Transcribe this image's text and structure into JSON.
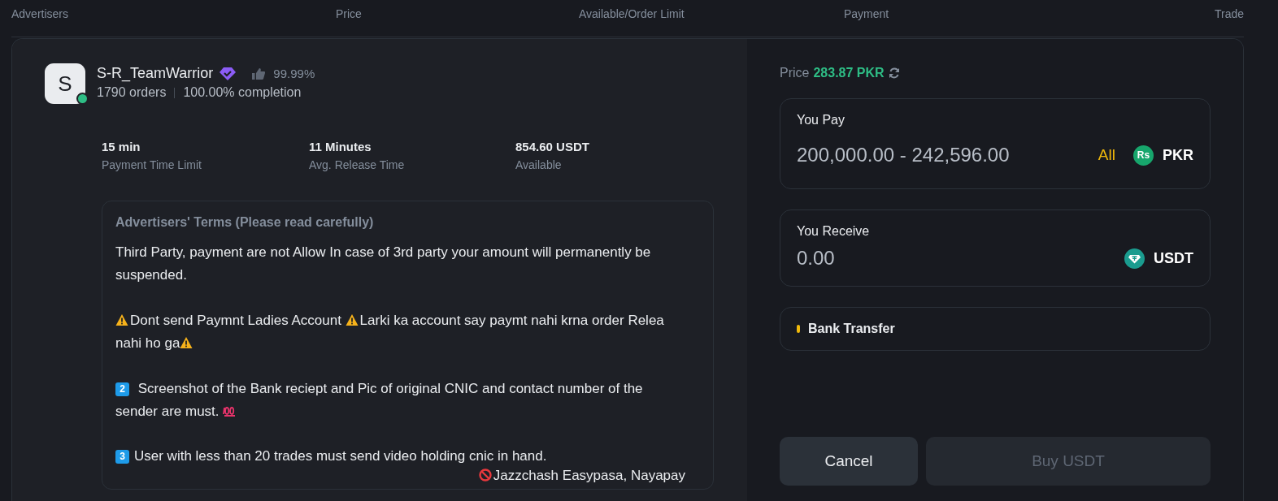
{
  "table": {
    "columns": [
      "Advertisers",
      "Price",
      "Available/Order Limit",
      "Payment",
      "Trade"
    ]
  },
  "advertiser": {
    "avatar_letter": "S",
    "online": true,
    "name": "S-R_TeamWarrior",
    "verified": true,
    "rating": "99.99%",
    "orders": "1790 orders",
    "completion": "100.00% completion",
    "stats": [
      {
        "value": "15 min",
        "label": "Payment Time Limit"
      },
      {
        "value": "11 Minutes",
        "label": "Avg. Release Time"
      },
      {
        "value": "854.60 USDT",
        "label": "Available"
      }
    ]
  },
  "terms": {
    "title": "Advertisers' Terms (Please read carefully)",
    "paragraphs": [
      {
        "lines": [
          [
            {
              "kind": "text",
              "text": "Third Party, payment are  not Allow In case of 3rd party your amount will permanently be"
            }
          ],
          [
            {
              "kind": "text",
              "text": "suspended."
            }
          ]
        ]
      },
      {
        "lines": [
          [
            {
              "kind": "warning"
            },
            {
              "kind": "text",
              "text": "Dont send Paymnt Ladies Account "
            },
            {
              "kind": "warning"
            },
            {
              "kind": "text",
              "text": "Larki  ka account say paymt nahi krna order Relea"
            }
          ],
          [
            {
              "kind": "text",
              "text": "nahi ho ga"
            },
            {
              "kind": "warning"
            }
          ]
        ]
      },
      {
        "lines": [
          [
            {
              "kind": "keycap",
              "text": "2"
            },
            {
              "kind": "text",
              "text": " Screenshot of the Bank reciept and Pic of original CNIC and contact number of the"
            }
          ],
          [
            {
              "kind": "text",
              "text": "sender are must. "
            },
            {
              "kind": "hundred"
            }
          ]
        ]
      },
      {
        "lines": [
          [
            {
              "kind": "keycap",
              "text": "3"
            },
            {
              "kind": "text",
              "text": "User with less than 20 trades must send video holding cnic in hand."
            }
          ]
        ]
      },
      {
        "right_aligned": true,
        "lines": [
          [
            {
              "kind": "no-entry"
            },
            {
              "kind": "text",
              "text": "Jazzchash Easypasa,  Nayapay"
            }
          ]
        ]
      }
    ]
  },
  "order": {
    "price_label": "Price",
    "price": "283.87 PKR",
    "pay": {
      "label": "You Pay",
      "placeholder": "200,000.00 - 242,596.00",
      "all": "All",
      "currency_badge": "Rs",
      "currency": "PKR"
    },
    "receive": {
      "label": "You Receive",
      "placeholder": "0.00",
      "currency": "USDT"
    },
    "payment_method": {
      "name": "Bank Transfer",
      "color": "#f0b90b"
    },
    "buttons": [
      {
        "label": "Cancel",
        "kind": "secondary",
        "disabled": false
      },
      {
        "label": "Buy USDT",
        "kind": "primary",
        "disabled": true
      }
    ]
  }
}
